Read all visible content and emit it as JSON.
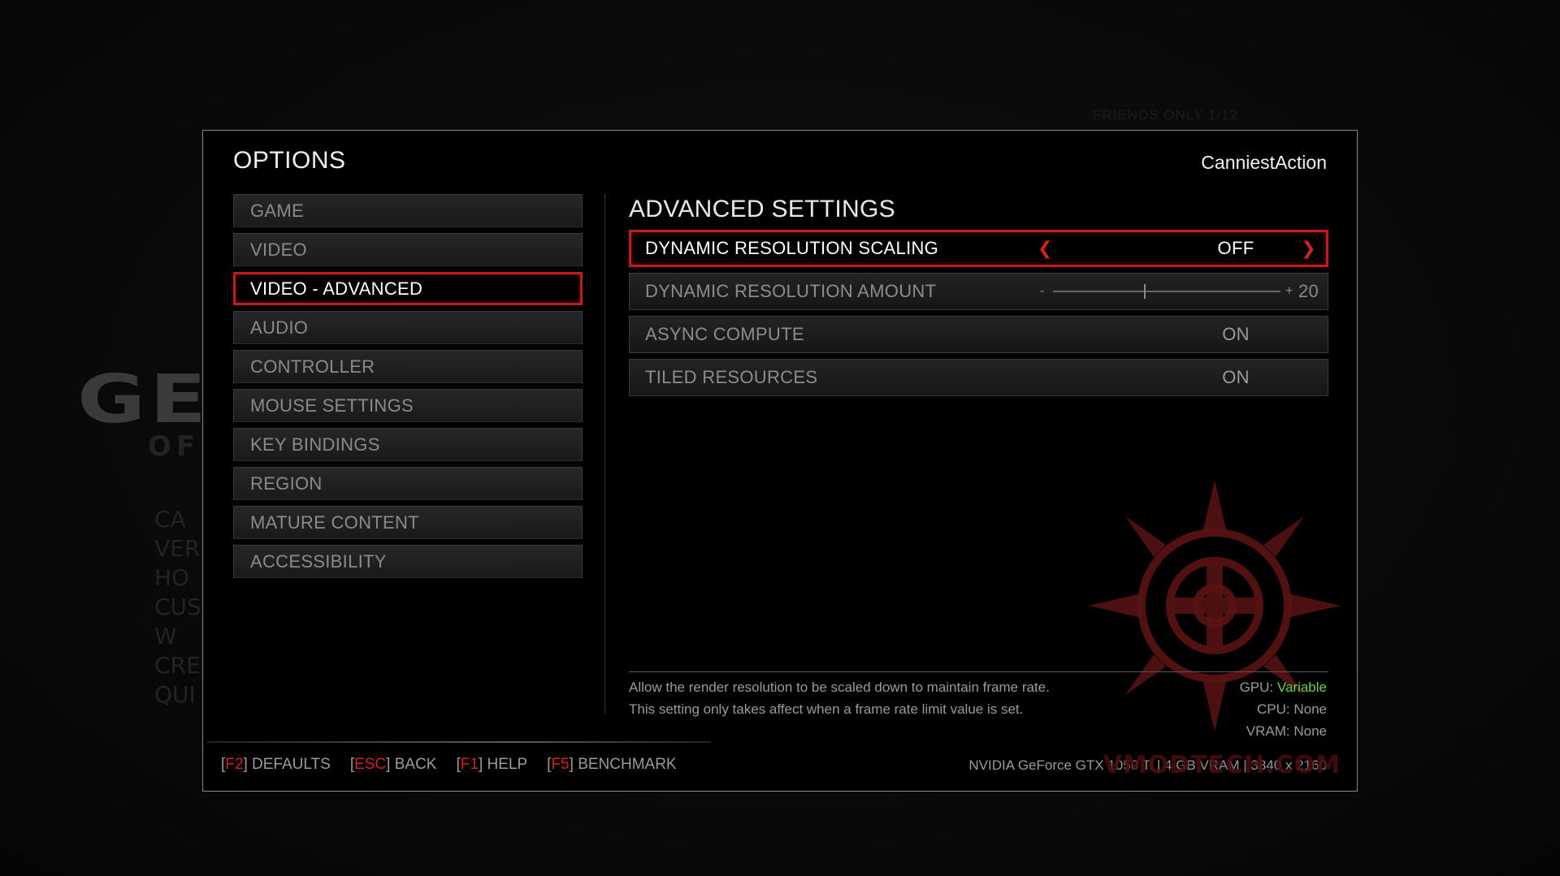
{
  "background": {
    "logo_text": "GE",
    "logo_sub": "OF",
    "menu_fragments": [
      "CA",
      "VER",
      "HO",
      "CUS",
      "W",
      "",
      "CRE",
      "QUI"
    ],
    "top_right_text": "FRIENDS ONLY 1/12"
  },
  "header": {
    "title": "OPTIONS",
    "username": "CanniestAction"
  },
  "nav": {
    "items": [
      {
        "label": "GAME"
      },
      {
        "label": "VIDEO"
      },
      {
        "label": "VIDEO - ADVANCED"
      },
      {
        "label": "AUDIO"
      },
      {
        "label": "CONTROLLER"
      },
      {
        "label": "MOUSE SETTINGS"
      },
      {
        "label": "KEY BINDINGS"
      },
      {
        "label": "REGION"
      },
      {
        "label": "MATURE CONTENT"
      },
      {
        "label": "ACCESSIBILITY"
      }
    ],
    "active_index": 2
  },
  "section": {
    "title": "ADVANCED SETTINGS"
  },
  "settings": [
    {
      "label": "DYNAMIC RESOLUTION SCALING",
      "value": "OFF"
    },
    {
      "label": "DYNAMIC RESOLUTION AMOUNT",
      "slider_min_label": "-",
      "slider_max_label": "+",
      "value": "20",
      "slider_fraction": 0.4
    },
    {
      "label": "ASYNC COMPUTE",
      "value": "ON"
    },
    {
      "label": "TILED RESOURCES",
      "value": "ON"
    }
  ],
  "description": {
    "line1": "Allow the render resolution to be scaled down to maintain frame rate.",
    "line2": "This setting only takes affect when a frame rate limit value is set."
  },
  "specs": {
    "gpu_label": "GPU:",
    "gpu_value": "Variable",
    "cpu": "CPU: None",
    "vram": "VRAM: None"
  },
  "footer": {
    "hints": [
      {
        "key": "F2",
        "label": "DEFAULTS"
      },
      {
        "key": "ESC",
        "label": "BACK"
      },
      {
        "key": "F1",
        "label": "HELP"
      },
      {
        "key": "F5",
        "label": "BENCHMARK"
      }
    ],
    "system_info": "NVIDIA GeForce GTX 1050 Ti | 4 GB VRAM | 3840 x 2160"
  },
  "watermark": "VMODTECH.COM",
  "colors": {
    "accent_red": "#c11d1d",
    "arrow_red": "#d3231f",
    "green": "#6fcf4a"
  }
}
